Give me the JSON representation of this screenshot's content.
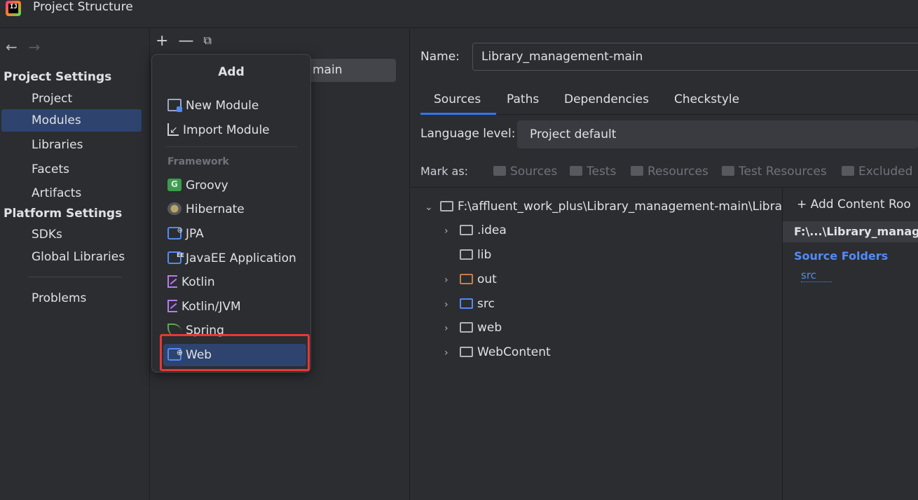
{
  "window": {
    "title": "Project Structure",
    "app_icon": "intellij-icon"
  },
  "nav": {
    "back_icon": "←",
    "forward_icon": "→",
    "project_settings_heading": "Project Settings",
    "project_settings_items": [
      "Project",
      "Modules",
      "Libraries",
      "Facets",
      "Artifacts"
    ],
    "platform_settings_heading": "Platform Settings",
    "platform_settings_items": [
      "SDKs",
      "Global Libraries"
    ],
    "problems": "Problems",
    "selected": "Modules"
  },
  "modules": {
    "toolbar": {
      "add": "+",
      "remove": "—",
      "copy": "⧉"
    },
    "module_name_suffix": "main"
  },
  "popup": {
    "title": "Add",
    "actions": [
      "New Module",
      "Import Module"
    ],
    "framework_group": "Framework",
    "frameworks": [
      "Groovy",
      "Hibernate",
      "JPA",
      "JavaEE Application",
      "Kotlin",
      "Kotlin/JVM",
      "Spring",
      "Web"
    ],
    "selected": "Web"
  },
  "detail": {
    "name_label": "Name:",
    "name_value": "Library_management-main",
    "tabs": [
      "Sources",
      "Paths",
      "Dependencies",
      "Checkstyle"
    ],
    "active_tab": "Sources",
    "language_level_label": "Language level:",
    "language_level_value": "Project default",
    "mark_as_label": "Mark as:",
    "mark_as_buttons": [
      "Sources",
      "Tests",
      "Resources",
      "Test Resources",
      "Excluded"
    ]
  },
  "tree": {
    "root": "F:\\affluent_work_plus\\Library_management-main\\Libra",
    "children": [
      ".idea",
      "lib",
      "out",
      "src",
      "web",
      "WebContent"
    ]
  },
  "content_roots": {
    "add_label": "Add Content Roo",
    "root_path": "F:\\...\\Library_manage",
    "source_folders_title": "Source Folders",
    "source_entries": [
      "src"
    ]
  },
  "colors": {
    "background": "#2b2d30",
    "selection": "#2e436e",
    "accent": "#3574f0",
    "highlight": "#e53935",
    "link": "#548af7"
  }
}
